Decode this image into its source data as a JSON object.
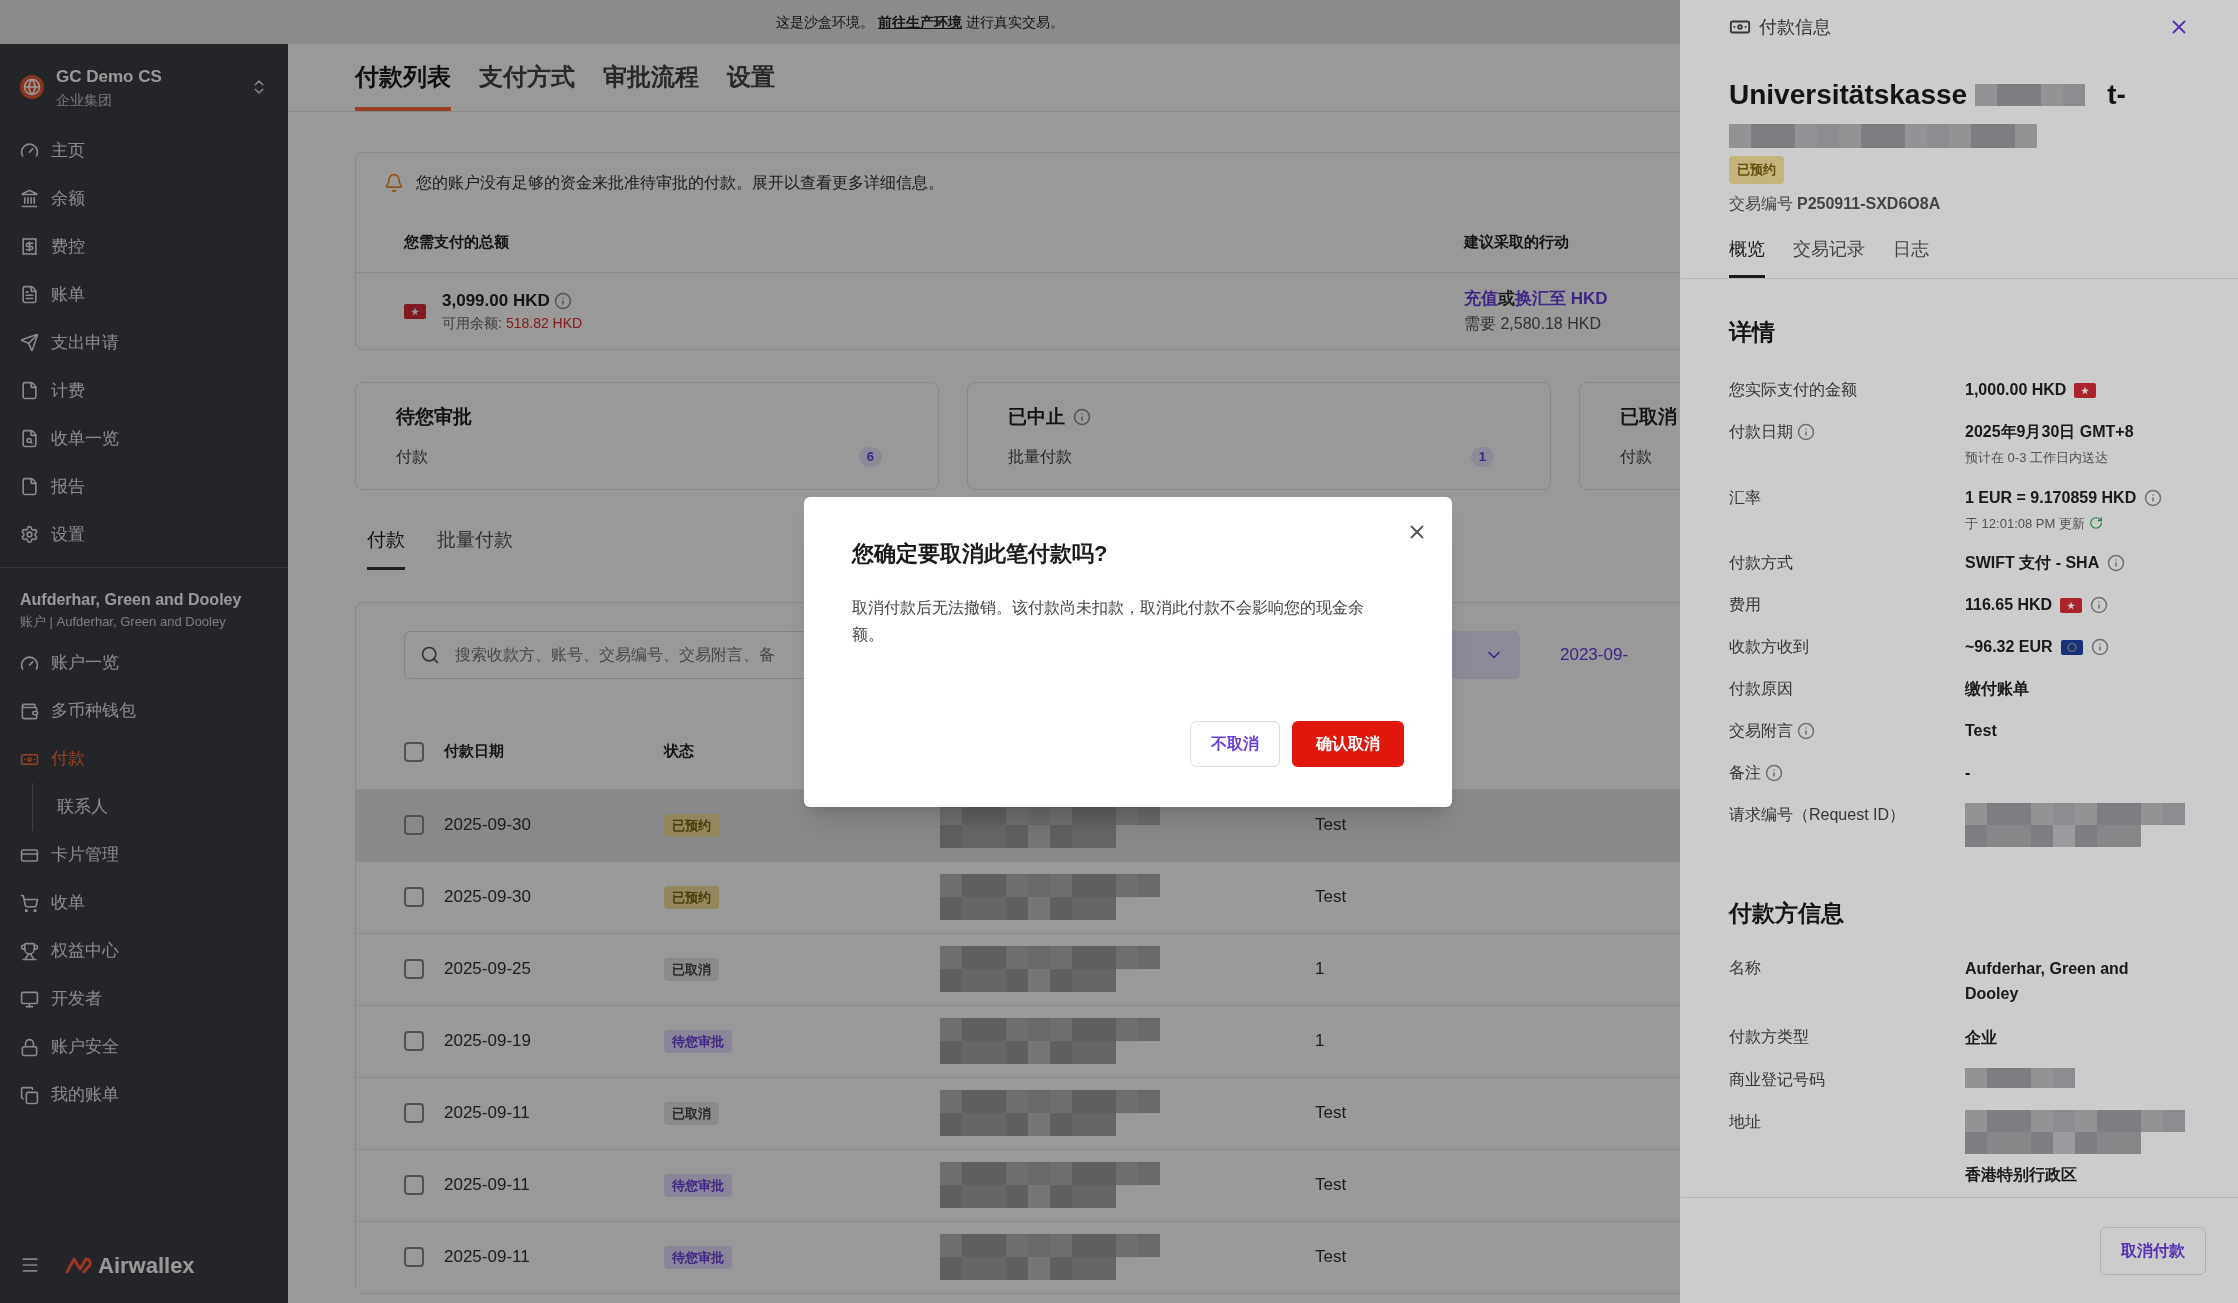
{
  "banner": {
    "text_before": "这是沙盒环境。",
    "link": "前往生产环境",
    "text_after": "进行真实交易。"
  },
  "org": {
    "name": "GC Demo CS",
    "subtitle": "企业集团"
  },
  "nav_global": [
    {
      "label": "主页",
      "selected": false
    },
    {
      "label": "余额",
      "selected": false
    },
    {
      "label": "费控",
      "selected": false
    },
    {
      "label": "账单",
      "selected": false
    },
    {
      "label": "支出申请",
      "selected": false
    },
    {
      "label": "计费",
      "selected": false
    },
    {
      "label": "收单一览",
      "selected": false
    },
    {
      "label": "报告",
      "selected": false
    },
    {
      "label": "设置",
      "selected": false
    }
  ],
  "account": {
    "name": "Aufderhar, Green and Dooley",
    "subtitle": "账户 | Aufderhar, Green and Dooley"
  },
  "nav_account": [
    {
      "label": "账户一览",
      "selected": false
    },
    {
      "label": "多币种钱包",
      "selected": false
    },
    {
      "label": "付款",
      "selected": true,
      "children": [
        {
          "label": "联系人",
          "selected": false
        }
      ]
    },
    {
      "label": "卡片管理",
      "selected": false
    },
    {
      "label": "收单",
      "selected": false
    },
    {
      "label": "权益中心",
      "selected": false
    },
    {
      "label": "开发者",
      "selected": false
    },
    {
      "label": "账户安全",
      "selected": false
    },
    {
      "label": "我的账单",
      "selected": false
    }
  ],
  "logo": "Airwallex",
  "page_tabs": [
    {
      "label": "付款列表",
      "selected": true
    },
    {
      "label": "支付方式",
      "selected": false
    },
    {
      "label": "审批流程",
      "selected": false
    },
    {
      "label": "设置",
      "selected": false
    }
  ],
  "alert": {
    "message": "您的账户没有足够的资金来批准待审批的付款。展开以查看更多详细信息。",
    "total_label": "您需支付的总额",
    "action_label": "建议采取的行动",
    "amount": "3,099.00 HKD",
    "available_label": "可用余额:",
    "available": "518.82 HKD",
    "action_link_1": "充值",
    "action_or": "或",
    "action_link_2": "换汇至 HKD",
    "need": "需要 2,580.18 HKD"
  },
  "summary_cards": [
    {
      "title": "待您审批",
      "info": false,
      "sub": "付款",
      "count": "6"
    },
    {
      "title": "已中止",
      "info": true,
      "sub": "批量付款",
      "count": "1"
    },
    {
      "title": "已取消",
      "info": false,
      "sub": "付款"
    }
  ],
  "list_tabs": [
    {
      "label": "付款",
      "selected": true
    },
    {
      "label": "批量付款",
      "selected": false
    }
  ],
  "search": {
    "placeholder": "搜索收款方、账号、交易编号、交易附言、备"
  },
  "date_filter": "2023-09-",
  "table": {
    "select_all_checked": false,
    "columns": [
      "付款日期",
      "状态"
    ],
    "rows": [
      {
        "checked": false,
        "selected": true,
        "date": "2025-09-30",
        "status": "已预约",
        "kind": "scheduled",
        "note": "Test"
      },
      {
        "checked": false,
        "selected": false,
        "date": "2025-09-30",
        "status": "已预约",
        "kind": "scheduled",
        "note": "Test"
      },
      {
        "checked": false,
        "selected": false,
        "date": "2025-09-25",
        "status": "已取消",
        "kind": "cancelled",
        "note": "1"
      },
      {
        "checked": false,
        "selected": false,
        "date": "2025-09-19",
        "status": "待您审批",
        "kind": "pending",
        "note": "1"
      },
      {
        "checked": false,
        "selected": false,
        "date": "2025-09-11",
        "status": "已取消",
        "kind": "cancelled",
        "note": "Test"
      },
      {
        "checked": false,
        "selected": false,
        "date": "2025-09-11",
        "status": "待您审批",
        "kind": "pending",
        "note": "Test"
      },
      {
        "checked": false,
        "selected": false,
        "date": "2025-09-11",
        "status": "待您审批",
        "kind": "pending",
        "note": "Test"
      }
    ]
  },
  "drawer": {
    "header": "付款信息",
    "title_start": "Universitätskasse",
    "title_end": "t-",
    "status": "已预约",
    "txn_label": "交易编号",
    "txn_id": "P250911-SXD6O8A",
    "tabs": [
      {
        "label": "概览",
        "selected": true
      },
      {
        "label": "交易记录",
        "selected": false
      },
      {
        "label": "日志",
        "selected": false
      }
    ],
    "details_title": "详情",
    "details": [
      {
        "label": "您实际支付的金额",
        "label_info": false,
        "value": "1,000.00 HKD",
        "flag": {
          "kind": "hk"
        },
        "value_info": false,
        "redacted": false
      },
      {
        "label": "付款日期",
        "label_info": true,
        "value": "2025年9月30日 GMT+8",
        "sub": "预计在 0-3 工作日内送达",
        "value_info": false,
        "redacted": false
      },
      {
        "label": "汇率",
        "label_info": false,
        "value": "1 EUR = 9.170859 HKD",
        "value_info": true,
        "sub": "于 12:01:08 PM 更新",
        "refresh": true,
        "redacted": false
      },
      {
        "label": "付款方式",
        "label_info": false,
        "value": "SWIFT 支付 - SHA",
        "value_info": true,
        "redacted": false
      },
      {
        "label": "费用",
        "label_info": false,
        "value": "116.65 HKD",
        "flag": {
          "kind": "hk"
        },
        "value_info": true,
        "redacted": false
      },
      {
        "label": "收款方收到",
        "label_info": false,
        "value": "~96.32 EUR",
        "flag": {
          "kind": "eu"
        },
        "value_info": true,
        "redacted": false
      },
      {
        "label": "付款原因",
        "label_info": false,
        "value": "缴付账单",
        "value_info": false,
        "redacted": false
      },
      {
        "label": "交易附言",
        "label_info": true,
        "value": "Test",
        "value_info": false,
        "redacted": false
      },
      {
        "label": "备注",
        "label_info": true,
        "value": "-",
        "value_info": false,
        "redacted": false
      },
      {
        "label": "请求编号（Request ID）",
        "label_info": false,
        "redacted": true
      }
    ],
    "payer_title": "付款方信息",
    "payer": [
      {
        "label": "名称",
        "value": "Aufderhar, Green and Dooley",
        "redacted": false
      },
      {
        "label": "付款方类型",
        "value": "企业",
        "redacted": false
      },
      {
        "label": "商业登记号码",
        "redacted": true
      },
      {
        "label": "地址",
        "value": "香港特别行政区",
        "redacted": true
      }
    ],
    "cancel_button": "取消付款"
  },
  "modal": {
    "title": "您确定要取消此笔付款吗?",
    "body": "取消付款后无法撤销。该付款尚未扣款，取消此付款不会影响您的现金余额。",
    "cancel": "不取消",
    "confirm": "确认取消"
  }
}
